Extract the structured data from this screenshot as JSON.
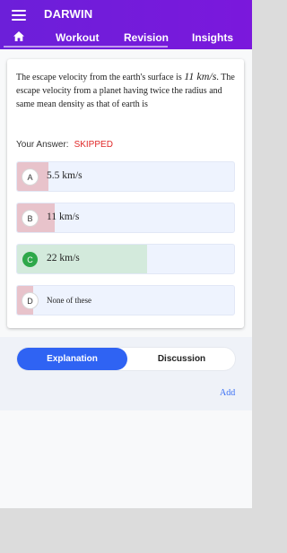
{
  "header": {
    "app_title": "DARWIN",
    "menu_icon": "hamburger-menu-icon",
    "tabs": [
      {
        "icon": "home-icon"
      },
      {
        "label": "Workout"
      },
      {
        "label": "Revision"
      },
      {
        "label": "Insights"
      }
    ]
  },
  "question": {
    "text_part1": "The escape velocity from the earth's surface is ",
    "math": "11 km/s",
    "text_part2": ". The escape velocity from a planet having twice the radius and same mean density as that of earth is",
    "your_answer_label": "Your Answer:",
    "your_answer_status": "SKIPPED",
    "options": [
      {
        "letter": "A",
        "text": "5.5 km/s",
        "status": "incorrect"
      },
      {
        "letter": "B",
        "text": "11 km/s",
        "status": "incorrect"
      },
      {
        "letter": "C",
        "text": "22 km/s",
        "status": "correct"
      },
      {
        "letter": "D",
        "text": "None of these",
        "status": "incorrect"
      }
    ]
  },
  "toggle": {
    "explanation_label": "Explanation",
    "discussion_label": "Discussion"
  },
  "add_label": "Add",
  "colors": {
    "header": "#6c1fd9",
    "correct": "#2ea84a",
    "correct_fill": "#d3eadc",
    "incorrect_fill": "#e8c3cb",
    "skipped": "#e02828",
    "accent": "#2f63f3"
  }
}
